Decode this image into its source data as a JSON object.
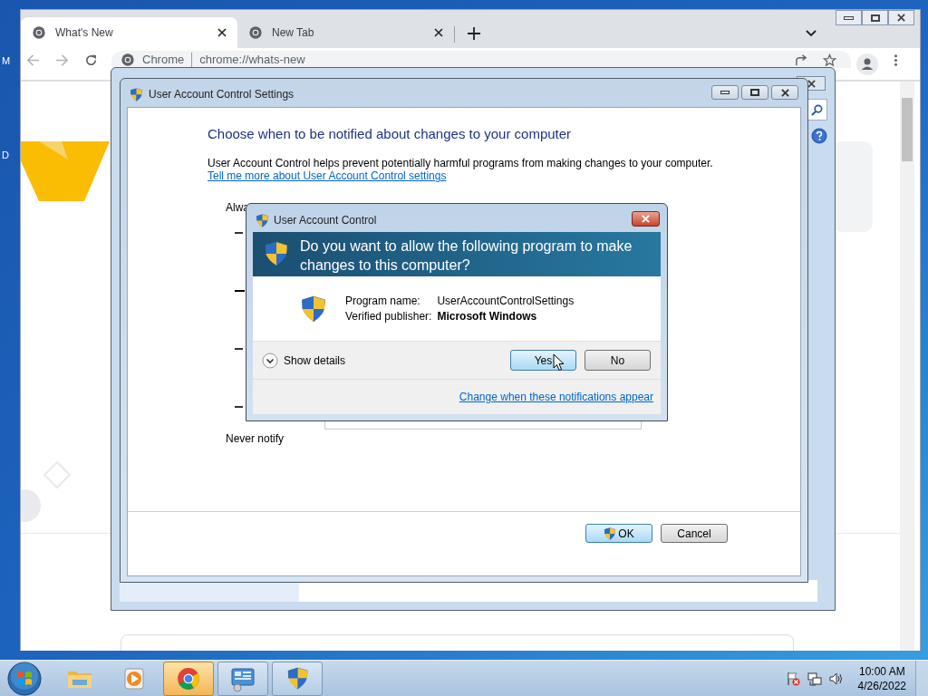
{
  "desktop": {
    "icon_labels": [
      "M",
      "D"
    ]
  },
  "browser": {
    "tabs": [
      {
        "title": "What's New",
        "selected": true
      },
      {
        "title": "New Tab",
        "selected": false
      }
    ],
    "omnibox": {
      "site": "Chrome",
      "url": "chrome://whats-new"
    }
  },
  "uac_settings": {
    "title": "User Account Control Settings",
    "heading": "Choose when to be notified about changes to your computer",
    "description": "User Account Control helps prevent potentially harmful programs from making changes to your computer.",
    "link": "Tell me more about User Account Control settings",
    "top_label": "Alwa",
    "bottom_label": "Never notify",
    "buttons": [
      {
        "label": "OK",
        "shield": true
      },
      {
        "label": "Cancel",
        "shield": false
      }
    ]
  },
  "uac_prompt": {
    "title": "User Account Control",
    "question": "Do you want to allow the following program to make changes to this computer?",
    "fields": [
      {
        "label": "Program name:",
        "value": "UserAccountControlSettings",
        "bold": false
      },
      {
        "label": "Verified publisher:",
        "value": "Microsoft Windows",
        "bold": true
      }
    ],
    "details": "Show details",
    "buttons": [
      {
        "label": "Yes",
        "default": true
      },
      {
        "label": "No",
        "default": false
      }
    ],
    "link": "Change when these notifications appear"
  },
  "taskbar": {
    "apps": [
      {
        "kind": "explorer",
        "open": false,
        "highlighted": false
      },
      {
        "kind": "media",
        "open": false,
        "highlighted": false
      },
      {
        "kind": "chrome",
        "open": true,
        "highlighted": true
      },
      {
        "kind": "control-panel",
        "open": true,
        "highlighted": false
      },
      {
        "kind": "shield",
        "open": true,
        "highlighted": false
      }
    ],
    "time": "10:00 AM",
    "date": "4/26/2022"
  }
}
